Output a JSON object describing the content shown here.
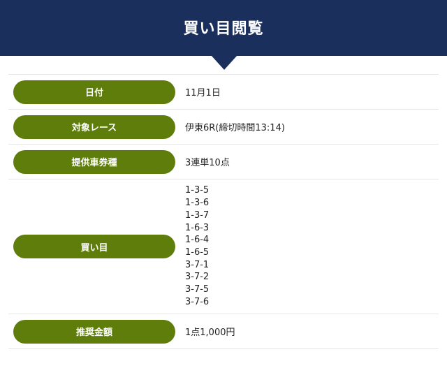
{
  "header": {
    "title": "買い目閲覧"
  },
  "rows": [
    {
      "label": "日付",
      "value": "11月1日"
    },
    {
      "label": "対象レース",
      "value": "伊東6R(締切時間13:14)"
    },
    {
      "label": "提供車券種",
      "value": "3連単10点"
    },
    {
      "label": "買い目",
      "values": [
        "1-3-5",
        "1-3-6",
        "1-3-7",
        "1-6-3",
        "1-6-4",
        "1-6-5",
        "3-7-1",
        "3-7-2",
        "3-7-5",
        "3-7-6"
      ]
    },
    {
      "label": "推奨金額",
      "value": "1点1,000円"
    }
  ],
  "colors": {
    "header_bg": "#1b2f5c",
    "pill_bg": "#5e7d0b",
    "divider": "#e6e6e6"
  }
}
